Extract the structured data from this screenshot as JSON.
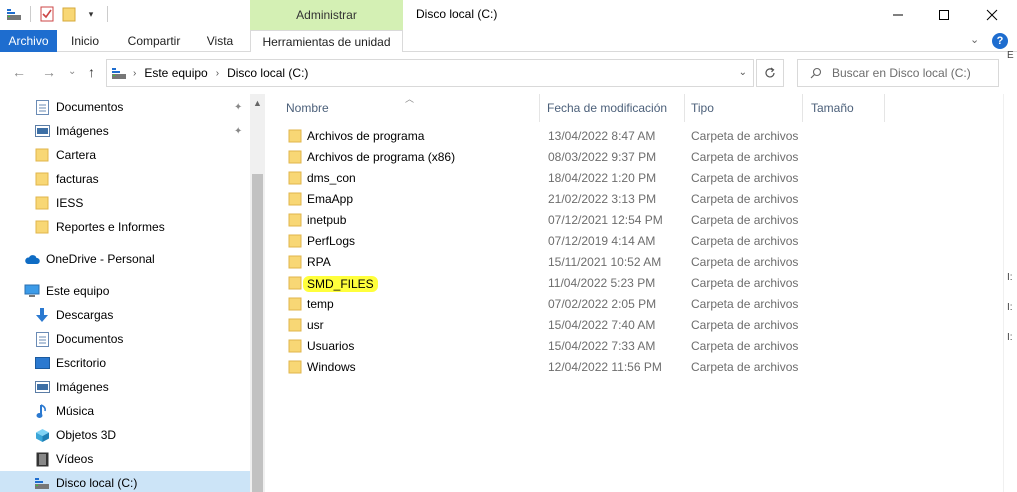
{
  "window": {
    "title": "Disco local (C:)",
    "context_tab_group": "Administrar"
  },
  "ribbon": {
    "tabs": [
      "Archivo",
      "Inicio",
      "Compartir",
      "Vista",
      "Herramientas de unidad"
    ],
    "active_tab": "Herramientas de unidad",
    "help": "?"
  },
  "address": {
    "segments": [
      "Este equipo",
      "Disco local (C:)"
    ]
  },
  "search": {
    "placeholder": "Buscar en Disco local (C:)"
  },
  "nav": {
    "quick_access": [
      {
        "label": "Documentos",
        "icon": "documents-icon",
        "pinned": true
      },
      {
        "label": "Imágenes",
        "icon": "pictures-icon",
        "pinned": true
      },
      {
        "label": "Cartera",
        "icon": "folder-icon",
        "pinned": false
      },
      {
        "label": "facturas",
        "icon": "folder-icon",
        "pinned": false
      },
      {
        "label": "IESS",
        "icon": "folder-icon",
        "pinned": false
      },
      {
        "label": "Reportes e Informes",
        "icon": "folder-icon",
        "pinned": false
      }
    ],
    "onedrive": {
      "label": "OneDrive - Personal",
      "icon": "cloud-icon"
    },
    "this_pc": {
      "label": "Este equipo",
      "icon": "computer-icon"
    },
    "this_pc_items": [
      {
        "label": "Descargas",
        "icon": "downloads-icon"
      },
      {
        "label": "Documentos",
        "icon": "documents-icon"
      },
      {
        "label": "Escritorio",
        "icon": "desktop-icon"
      },
      {
        "label": "Imágenes",
        "icon": "pictures-icon"
      },
      {
        "label": "Música",
        "icon": "music-icon"
      },
      {
        "label": "Objetos 3D",
        "icon": "objects-3d-icon"
      },
      {
        "label": "Vídeos",
        "icon": "videos-icon"
      },
      {
        "label": "Disco local (C:)",
        "icon": "drive-icon",
        "selected": true
      }
    ]
  },
  "columns": {
    "name": "Nombre",
    "date": "Fecha de modificación",
    "type": "Tipo",
    "size": "Tamaño"
  },
  "files": [
    {
      "name": "Archivos de programa",
      "date": "13/04/2022 8:47 AM",
      "type": "Carpeta de archivos"
    },
    {
      "name": "Archivos de programa (x86)",
      "date": "08/03/2022 9:37 PM",
      "type": "Carpeta de archivos"
    },
    {
      "name": "dms_con",
      "date": "18/04/2022 1:20 PM",
      "type": "Carpeta de archivos"
    },
    {
      "name": "EmaApp",
      "date": "21/02/2022 3:13 PM",
      "type": "Carpeta de archivos"
    },
    {
      "name": "inetpub",
      "date": "07/12/2021 12:54 PM",
      "type": "Carpeta de archivos"
    },
    {
      "name": "PerfLogs",
      "date": "07/12/2019 4:14 AM",
      "type": "Carpeta de archivos"
    },
    {
      "name": "RPA",
      "date": "15/11/2021 10:52 AM",
      "type": "Carpeta de archivos"
    },
    {
      "name": "SMD_FILES",
      "date": "11/04/2022 5:23 PM",
      "type": "Carpeta de archivos",
      "highlighted": true
    },
    {
      "name": "temp",
      "date": "07/02/2022 2:05 PM",
      "type": "Carpeta de archivos"
    },
    {
      "name": "usr",
      "date": "15/04/2022 7:40 AM",
      "type": "Carpeta de archivos"
    },
    {
      "name": "Usuarios",
      "date": "15/04/2022 7:33 AM",
      "type": "Carpeta de archivos"
    },
    {
      "name": "Windows",
      "date": "12/04/2022 11:56 PM",
      "type": "Carpeta de archivos"
    }
  ],
  "right_edge_glyphs": [
    "E",
    "I:",
    "I:",
    "I:"
  ],
  "colors": {
    "file_tab": "#1e6dcf",
    "context_tab": "#d4f0b4",
    "selected": "#cce4f7",
    "folder": "#f8d775",
    "highlight": "#ffff3c"
  }
}
